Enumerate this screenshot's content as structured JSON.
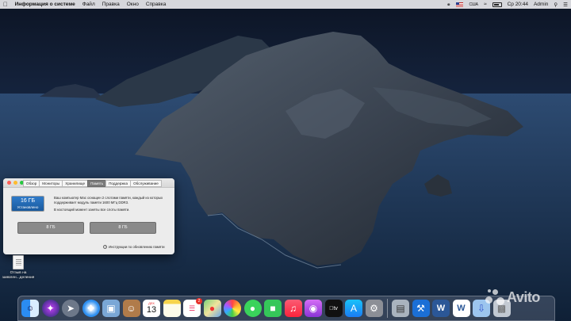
{
  "menubar": {
    "apple_icon": "apple-icon",
    "items": [
      "Информация о системе",
      "Файл",
      "Правка",
      "Окно",
      "Справка"
    ],
    "input_source": "США",
    "clock": "Ср 20:44",
    "user": "Admin"
  },
  "about_window": {
    "tabs": [
      "Обзор",
      "Мониторы",
      "Хранилище",
      "Память",
      "Поддержка",
      "Обслуживание"
    ],
    "active_tab": "Память",
    "memory_total": "16 ГБ",
    "memory_status": "Установлено",
    "description_1": "Ваш компьютер Mac оснащен 2 слотами памяти, каждый из которых поддерживает модуль памяти 1600 МГц DDR3.",
    "description_2": "В настоящий момент заняты все слоты памяти.",
    "slots": [
      "8 ГБ",
      "8 ГБ"
    ],
    "instructions_link": "Инструкции по обновлению памяти"
  },
  "desktop": {
    "file_label_1": "Отзыв на",
    "file_label_2": "заявлен...деления",
    "file_tag": "DOCX"
  },
  "dock": {
    "calendar_month": "ДЕК",
    "calendar_day": "13",
    "reminders_badge": "2"
  },
  "watermark": "Avito"
}
